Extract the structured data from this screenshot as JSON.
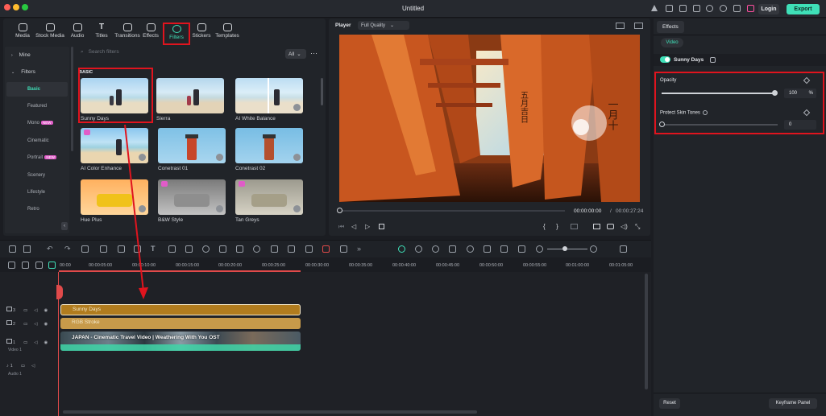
{
  "window": {
    "title": "Untitled",
    "login": "Login",
    "export": "Export"
  },
  "toolbar_tabs": [
    {
      "label": "Media"
    },
    {
      "label": "Stock Media"
    },
    {
      "label": "Audio"
    },
    {
      "label": "Titles"
    },
    {
      "label": "Transitions"
    },
    {
      "label": "Effects"
    },
    {
      "label": "Filters"
    },
    {
      "label": "Stickers"
    },
    {
      "label": "Templates"
    }
  ],
  "sidebar": {
    "mine": "Mine",
    "filters": "Filters",
    "items": [
      {
        "label": "Basic"
      },
      {
        "label": "Featured"
      },
      {
        "label": "Mono"
      },
      {
        "label": "Cinematic"
      },
      {
        "label": "Portrait"
      },
      {
        "label": "Scenery"
      },
      {
        "label": "Lifestyle"
      },
      {
        "label": "Retro"
      }
    ],
    "new_badge": "NEW"
  },
  "search": {
    "placeholder": "Search filters",
    "filter_value": "All"
  },
  "section_label": "BASIC",
  "filters": [
    {
      "label": "Sunny Days"
    },
    {
      "label": "Sierra"
    },
    {
      "label": "AI White Balance"
    },
    {
      "label": "AI Color Enhance"
    },
    {
      "label": "Conetrast 01"
    },
    {
      "label": "Conetrast 02"
    },
    {
      "label": "Hue Plus"
    },
    {
      "label": "B&W Style"
    },
    {
      "label": "Tan Greys"
    }
  ],
  "player": {
    "label": "Player",
    "quality": "Full Quality",
    "current_time": "00:00:00:00",
    "separator": "/",
    "total_time": "00:00:27:24"
  },
  "right_panel": {
    "tab": "Effects",
    "subtab": "Video",
    "effect_name": "Sunny Days",
    "opacity_label": "Opacity",
    "opacity_value": "100",
    "opacity_unit": "%",
    "opacity_level": 1.0,
    "skin_label": "Protect Skin Tones",
    "skin_value": "0",
    "skin_level": 0.0,
    "reset": "Reset",
    "keyframe": "Keyframe Panel"
  },
  "ruler": [
    "00:00",
    "00:00:05:00",
    "00:00:10:00",
    "00:00:15:00",
    "00:00:20:00",
    "00:00:25:00",
    "00:00:30:00",
    "00:00:35:00",
    "00:00:40:00",
    "00:00:45:00",
    "00:00:50:00",
    "00:00:55:00",
    "00:01:00:00",
    "00:01:05:00"
  ],
  "tracks": {
    "effect_clip": "Sunny Days",
    "effect2_clip": "RGB Stroke",
    "video_clip": "JAPAN - Cinematic Travel Video | Weathering With You OST",
    "track_numbers": [
      "3",
      "2",
      "1",
      "1"
    ],
    "video_label": "Video 1",
    "audio_label": "Audio 1"
  },
  "colors": {
    "accent": "#3fe0b8",
    "highlight_red": "#e0141e",
    "effect_clip": "#b17c1e",
    "audio_wave": "#3fd6a8"
  }
}
